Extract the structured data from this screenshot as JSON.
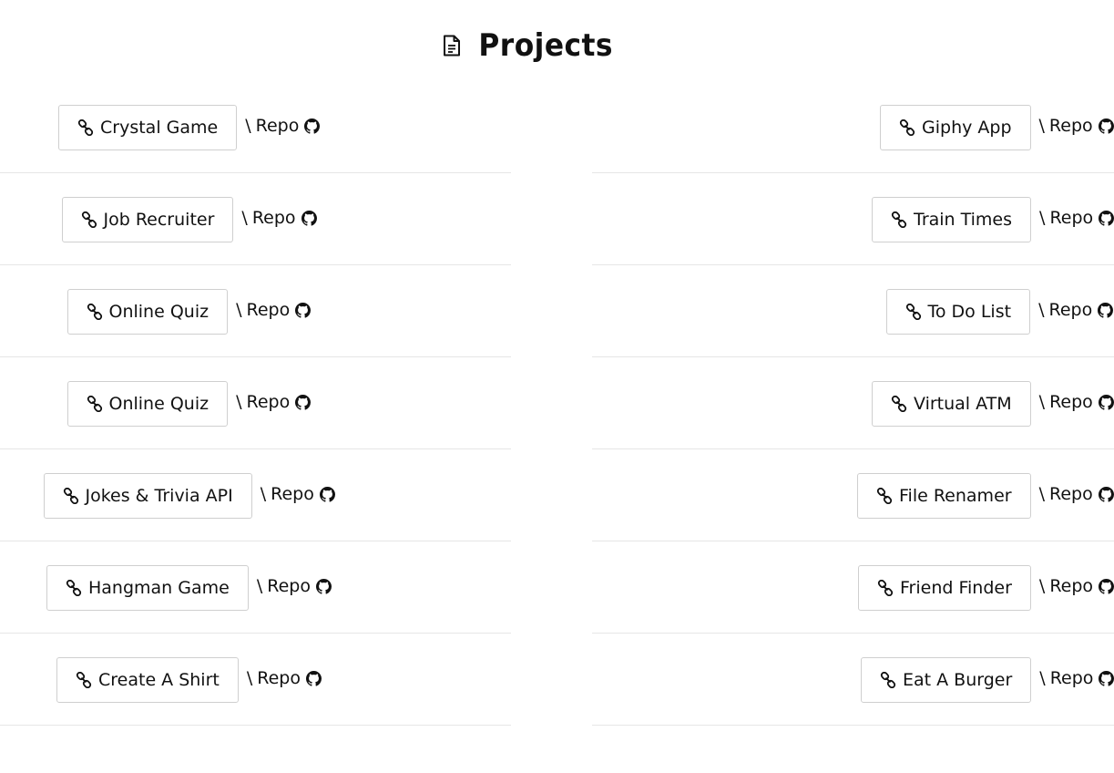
{
  "header": {
    "title": "Projects",
    "icon": "file-document-icon"
  },
  "separator": "\\",
  "repo_label": "Repo",
  "left_projects": [
    {
      "name": "Crystal Game"
    },
    {
      "name": "Job Recruiter"
    },
    {
      "name": "Online Quiz"
    },
    {
      "name": "Online Quiz"
    },
    {
      "name": "Jokes & Trivia API"
    },
    {
      "name": "Hangman Game"
    },
    {
      "name": "Create A Shirt"
    }
  ],
  "right_projects": [
    {
      "name": "Giphy App"
    },
    {
      "name": "Train Times"
    },
    {
      "name": "To Do List"
    },
    {
      "name": "Virtual ATM"
    },
    {
      "name": "File Renamer"
    },
    {
      "name": "Friend Finder"
    },
    {
      "name": "Eat A Burger"
    }
  ],
  "colors": {
    "border": "#cfcfcf",
    "divider": "#e6e6e6",
    "text": "#111111"
  }
}
